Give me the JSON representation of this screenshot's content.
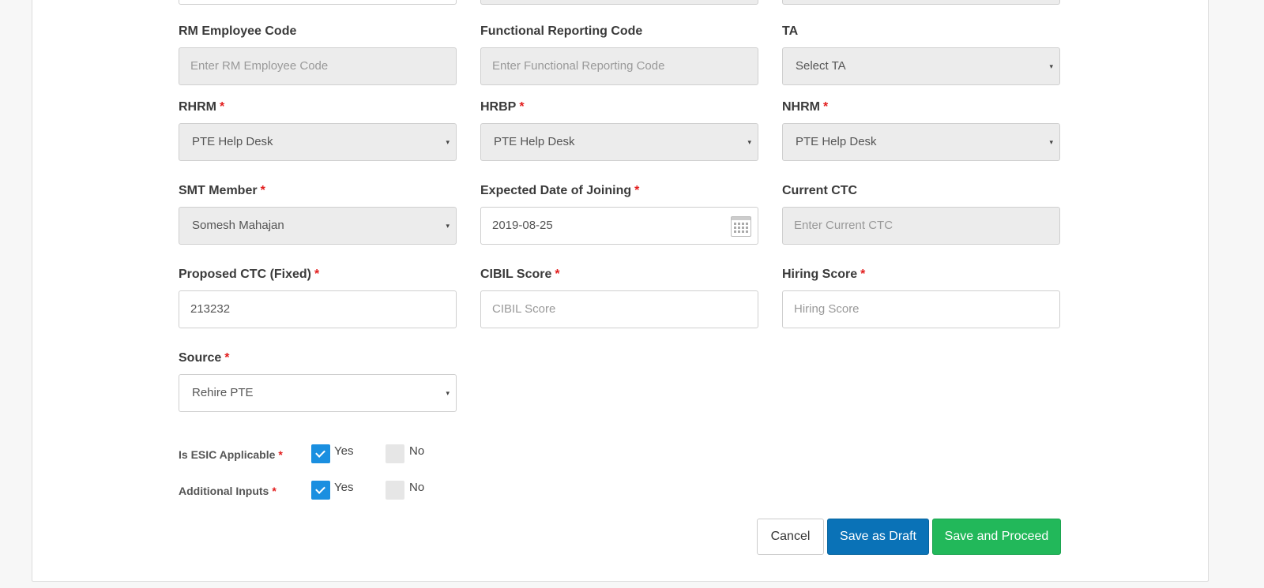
{
  "fields": {
    "rm_employee_code": {
      "label": "RM Employee Code",
      "placeholder": "Enter RM Employee Code"
    },
    "functional_reporting_code": {
      "label": "Functional Reporting Code",
      "placeholder": "Enter Functional Reporting Code"
    },
    "ta": {
      "label": "TA",
      "value": "Select TA"
    },
    "rhrm": {
      "label": "RHRM",
      "required": "*",
      "value": "PTE Help Desk"
    },
    "hrbp": {
      "label": "HRBP",
      "required": "*",
      "value": "PTE Help Desk"
    },
    "nhrm": {
      "label": "NHRM",
      "required": "*",
      "value": "PTE Help Desk"
    },
    "smt_member": {
      "label": "SMT Member",
      "required": "*",
      "value": "Somesh Mahajan"
    },
    "expected_doj": {
      "label": "Expected Date of Joining",
      "required": "*",
      "value": "2019-08-25"
    },
    "current_ctc": {
      "label": "Current CTC",
      "placeholder": "Enter Current CTC"
    },
    "proposed_ctc": {
      "label": "Proposed CTC (Fixed)",
      "required": "*",
      "value": "213232"
    },
    "cibil_score": {
      "label": "CIBIL Score",
      "required": "*",
      "placeholder": "CIBIL Score"
    },
    "hiring_score": {
      "label": "Hiring Score",
      "required": "*",
      "placeholder": "Hiring Score"
    },
    "source": {
      "label": "Source",
      "required": "*",
      "value": "Rehire PTE"
    }
  },
  "esic": {
    "label": "Is ESIC Applicable",
    "required": "*",
    "yes": "Yes",
    "no": "No",
    "selected": "Yes"
  },
  "additional_inputs": {
    "label": "Additional Inputs",
    "required": "*",
    "yes": "Yes",
    "no": "No",
    "selected": "Yes"
  },
  "buttons": {
    "cancel": "Cancel",
    "save_draft": "Save as Draft",
    "save_proceed": "Save and Proceed"
  },
  "icons": {
    "dropdown": "▾",
    "calendar": "calendar-icon"
  },
  "colors": {
    "primary": "#0a72b7",
    "success": "#22b85a",
    "checkbox": "#1a8fe0",
    "required": "#e21d1d"
  }
}
